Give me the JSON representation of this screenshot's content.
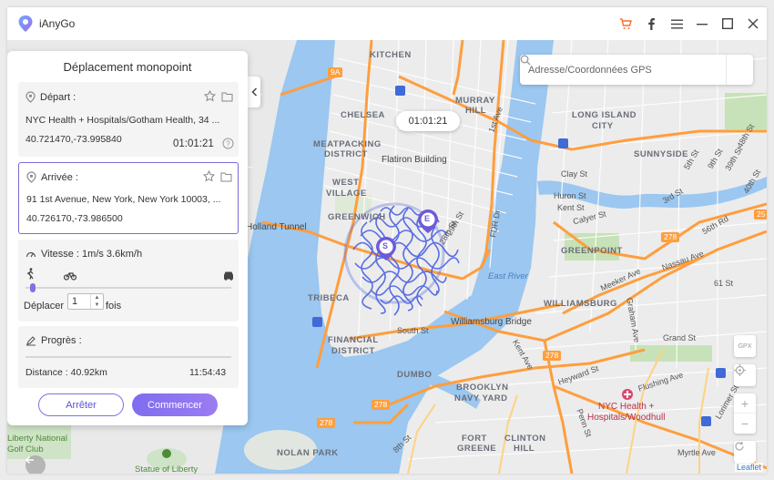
{
  "app": {
    "title": "iAnyGo",
    "accent": "#7b74e0",
    "titlebar_icons": [
      "cart-icon",
      "facebook-icon",
      "menu-icon",
      "minimize-icon",
      "maximize-icon",
      "close-icon"
    ]
  },
  "panel": {
    "title": "Déplacement monopoint",
    "start": {
      "label": "Départ :",
      "address": "NYC Health + Hospitals/Gotham Health, 34 ...",
      "coords": "40.721470,-73.995840",
      "time": "01:01:21"
    },
    "arrival": {
      "label": "Arrivée :",
      "address": "91 1st Avenue, New York, New York 10003, ...",
      "coords": "40.726170,-73.986500"
    },
    "speed": {
      "label": "Vitesse : 1m/s  3.6km/h",
      "modes": [
        "walk-icon",
        "bike-icon",
        "car-icon"
      ],
      "slider_fraction": 0.02
    },
    "repeat": {
      "prefix": "Déplacer",
      "value": "1",
      "suffix": "fois"
    },
    "progress": {
      "label": "Progrès :",
      "distance": "Distance : 40.92km",
      "time": "11:54:43",
      "fraction": 0
    },
    "buttons": {
      "stop": "Arrêter",
      "start": "Commencer"
    }
  },
  "map": {
    "search_placeholder": "Adresse/Coordonnées GPS",
    "timer": "01:01:21",
    "marker_start": "S",
    "marker_end": "E",
    "controls": {
      "gpx": "GPX"
    },
    "attribution": "Leaflet",
    "labels": {
      "kitchen": "KITCHEN",
      "chelsea": "CHELSEA",
      "murray": "MURRAY",
      "hill": "HILL",
      "long_island": "LONG ISLAND",
      "city": "CITY",
      "sunnyside": "SUNNYSIDE",
      "meatpacking1": "MEATPACKING",
      "meatpacking2": "DISTRICT",
      "flatiron": "Flatiron Building",
      "west": "WEST",
      "village": "VILLAGE",
      "greenwich": "GREENWICH",
      "holland": "Holland Tunnel",
      "tribeca": "TRIBECA",
      "financial1": "FINANCIAL",
      "financial2": "DISTRICT",
      "dumbo": "DUMBO",
      "brooklyn1": "BROOKLYN",
      "brooklyn2": "NAVY YARD",
      "williamsburg": "WILLIAMSBURG",
      "williamsburg_bridge": "Williamsburg Bridge",
      "greenpoint": "GREENPOINT",
      "east_river": "East River",
      "south_st": "South St",
      "fort1": "FORT",
      "fort2": "GREENE",
      "clinton1": "CLINTON",
      "clinton2": "HILL",
      "nolan": "NOLAN PARK",
      "statue": "Statue of Liberty",
      "liberty1": "Liberty National",
      "liberty2": "Golf Club",
      "nyc_health1": "NYC Health +",
      "nyc_health2": "Hospitals/Woodhull",
      "flushing": "Flushing Ave",
      "meeker": "Meeker Ave",
      "clay": "Clay St",
      "huron": "Huron St",
      "kent": "Kent St",
      "calyer": "Calyer St",
      "third_st": "3rd St",
      "fifth_st": "5th St",
      "ninth_st": "9th St",
      "st56": "56th Rd",
      "st48": "48th St",
      "st40": "40th St",
      "st39": "39th St",
      "kent_ave": "Kent Ave",
      "grand_st": "Grand St",
      "graham": "Graham Ave",
      "heyward": "Heyward St",
      "st29": "29th St",
      "st28": "28th St",
      "fdr": "FDR Dr",
      "ave1": "1st Ave",
      "st61": "61 St",
      "nassau": "Nassau Ave",
      "lorimer": "Lorimer St",
      "myrtle": "Myrtle Ave",
      "eigth_st": "8th St",
      "penn": "Penn St",
      "route278a": "278",
      "route278b": "278",
      "route278c": "278",
      "route278d": "278",
      "route9a": "9A",
      "route25": "25"
    }
  }
}
